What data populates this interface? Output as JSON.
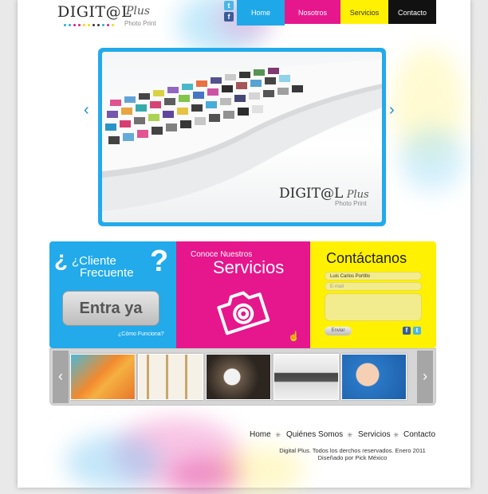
{
  "header": {
    "logo_main": "DIGIT@L",
    "logo_plus": "Plus",
    "logo_sub": "Photo Print"
  },
  "social": {
    "twitter": "t",
    "facebook": "f"
  },
  "nav": [
    {
      "label": "Home",
      "color": "#1fa8e8"
    },
    {
      "label": "Nosotros",
      "color": "#e6168d"
    },
    {
      "label": "Servicios",
      "color": "#fff101"
    },
    {
      "label": "Contacto",
      "color": "#111111"
    }
  ],
  "slider": {
    "prev": "‹",
    "next": "›",
    "watermark_main": "DIGIT@L",
    "watermark_plus": "Plus",
    "watermark_sub": "Photo Print"
  },
  "panel_cliente": {
    "title_line1": "¿Cliente",
    "title_line2": "Frecuente",
    "question_mark": "?",
    "button": "Entra ya",
    "link": "¿Cómo Funciona?"
  },
  "panel_servicios": {
    "subtitle": "Conoce Nuestros",
    "title": "Servicios"
  },
  "panel_contacto": {
    "title": "Contáctanos",
    "name_value": "Luis Carlos Portillo",
    "email_placeholder": "E-mail",
    "send": "Enviar"
  },
  "gallery": {
    "prev": "‹",
    "next": "›"
  },
  "footer": {
    "nav": [
      "Home",
      "Quiénes Somos",
      "Servicios",
      "Contacto"
    ],
    "separator": "✳",
    "copyright": "Digital Plus. Todos los derchos reservados. Enero 2011",
    "credit": "Diseñado por Pick México"
  },
  "colors": {
    "cyan": "#22aaeb",
    "magenta": "#e6168d",
    "yellow": "#fff101",
    "black": "#111111"
  }
}
